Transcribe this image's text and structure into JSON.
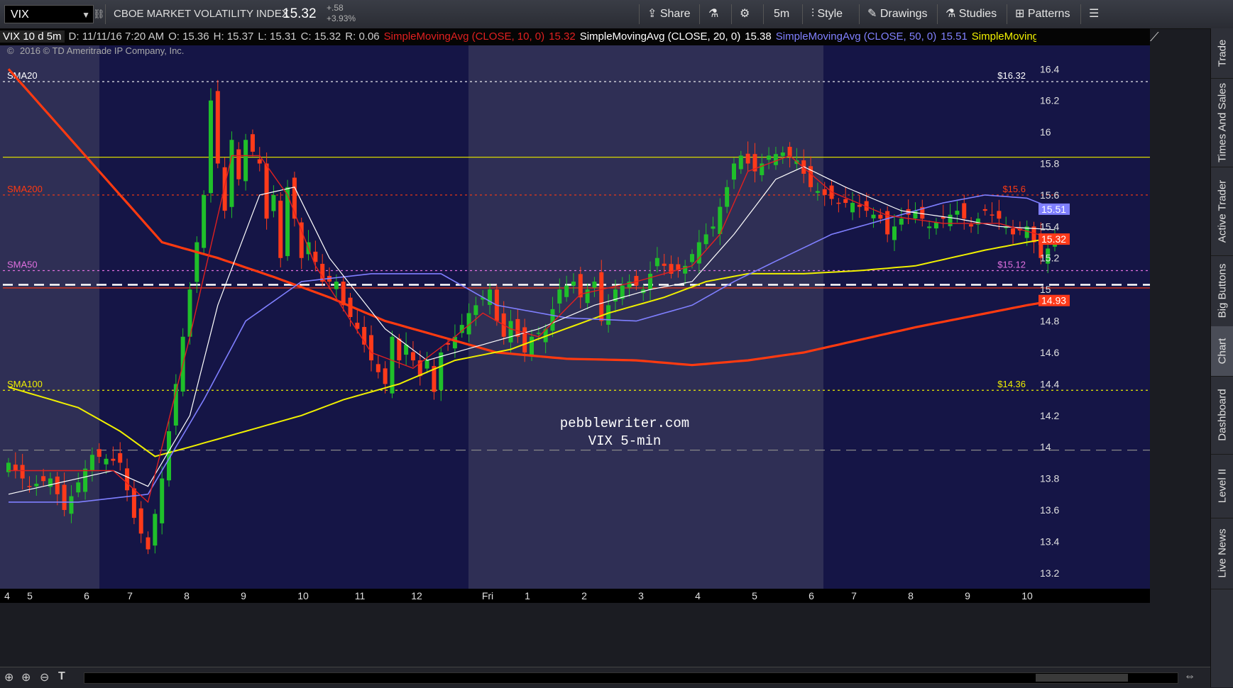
{
  "toolbar": {
    "symbol": "VIX",
    "index_name": "CBOE MARKET VOLATILITY INDEX",
    "last_price": "15.32",
    "change": "+.58",
    "change_pct": "+3.93%",
    "share_label": "Share",
    "timeframe_label": "5m",
    "style_label": "Style",
    "drawings_label": "Drawings",
    "studies_label": "Studies",
    "patterns_label": "Patterns"
  },
  "infobar": {
    "period": "VIX 10 d 5m",
    "date": "D: 11/11/16 7:20 AM",
    "open": "O: 15.36",
    "high": "H: 15.37",
    "low": "L: 15.31",
    "close": "C: 15.32",
    "range": "R: 0.06",
    "sma10_label": "SimpleMovingAvg (CLOSE, 10, 0)",
    "sma10_value": "15.32",
    "sma20_label": "SimpleMovingAvg (CLOSE, 20, 0)",
    "sma20_value": "15.38",
    "sma50_label": "SimpleMovingAvg (CLOSE, 50, 0)",
    "sma50_value": "15.51",
    "sma100_label": "SimpleMoving..."
  },
  "copyright": "2016 © TD Ameritrade IP Company, Inc.",
  "watermark": [
    "pebblewriter.com",
    "VIX 5-min"
  ],
  "colors": {
    "background": "#151546",
    "session_shade": "#2f2f55",
    "candle_up": "#1fbf2a",
    "candle_down": "#ff3a1a",
    "sma10": "#e02020",
    "sma20": "#ffffff",
    "sma50": "#7f7fff",
    "sma100": "#f0f000",
    "sma200": "#ff3a10"
  },
  "side_tabs": [
    "Trade",
    "Times And Sales",
    "Active Trader",
    "Big Buttons",
    "Chart",
    "Dashboard",
    "Level II",
    "Live News"
  ],
  "chart_data": {
    "type": "candlestick",
    "x_tick_labels": [
      "4",
      "5",
      "6",
      "7",
      "8",
      "9",
      "10",
      "11",
      "12",
      "Fri",
      "1",
      "2",
      "3",
      "4",
      "5",
      "6",
      "7",
      "8",
      "9",
      "10"
    ],
    "y_ticks": [
      16.4,
      16.2,
      16,
      15.8,
      15.6,
      15.4,
      15.2,
      15,
      14.8,
      14.6,
      14.4,
      14.2,
      14,
      13.8,
      13.6,
      13.4,
      13.2
    ],
    "ylim": [
      13.1,
      16.55
    ],
    "price_badges": [
      {
        "value": "15.51",
        "color": "#7f7fff"
      },
      {
        "value": "15.32",
        "color": "#ff3a1a"
      },
      {
        "value": "14.93",
        "color": "#ff3a1a"
      }
    ],
    "levels": [
      {
        "label": "SMA20",
        "value": 16.32,
        "value_text": "$16.32",
        "color": "#ffffff",
        "style": "dotted"
      },
      {
        "label": "SMA200",
        "value": 15.6,
        "value_text": "$15.6",
        "color": "#ff3a10",
        "style": "dotted"
      },
      {
        "label": "SMA50",
        "value": 15.12,
        "value_text": "$15.12",
        "color": "#e070e0",
        "style": "dotted"
      },
      {
        "label": "SMA100",
        "value": 14.36,
        "value_text": "$14.36",
        "color": "#f0f000",
        "style": "dotted"
      },
      {
        "label": "",
        "value": 15.84,
        "value_text": "",
        "color": "#d8d800",
        "style": "solid"
      },
      {
        "label": "",
        "value": 15.03,
        "value_text": "",
        "color": "#ffffff",
        "style": "dashed"
      },
      {
        "label": "",
        "value": 15.01,
        "value_text": "",
        "color": "#ff3a10",
        "style": "solid"
      },
      {
        "label": "",
        "value": 13.98,
        "value_text": "",
        "color": "#888888",
        "style": "dashed"
      }
    ],
    "price_anchors": [
      [
        0,
        13.9
      ],
      [
        3,
        13.75
      ],
      [
        6,
        13.8
      ],
      [
        8,
        13.6
      ],
      [
        12,
        13.95
      ],
      [
        16,
        13.9
      ],
      [
        18,
        13.55
      ],
      [
        20,
        13.35
      ],
      [
        22,
        13.8
      ],
      [
        24,
        14.4
      ],
      [
        26,
        15.0
      ],
      [
        28,
        15.6
      ],
      [
        29,
        16.2
      ],
      [
        30,
        15.8
      ],
      [
        31,
        15.5
      ],
      [
        32,
        15.95
      ],
      [
        33,
        15.7
      ],
      [
        34,
        15.95
      ],
      [
        36,
        15.8
      ],
      [
        37,
        15.45
      ],
      [
        38,
        15.6
      ],
      [
        39,
        15.2
      ],
      [
        40,
        15.65
      ],
      [
        41,
        15.45
      ],
      [
        42,
        15.2
      ],
      [
        43,
        15.3
      ],
      [
        45,
        15.05
      ],
      [
        47,
        15.05
      ],
      [
        48,
        14.9
      ],
      [
        50,
        14.75
      ],
      [
        52,
        14.55
      ],
      [
        54,
        14.4
      ],
      [
        55,
        14.7
      ],
      [
        56,
        14.55
      ],
      [
        57,
        14.65
      ],
      [
        59,
        14.45
      ],
      [
        60,
        14.55
      ],
      [
        61,
        14.35
      ],
      [
        62,
        14.6
      ],
      [
        64,
        14.7
      ],
      [
        66,
        14.85
      ],
      [
        68,
        14.95
      ],
      [
        69,
        15.0
      ],
      [
        70,
        14.8
      ],
      [
        71,
        14.7
      ],
      [
        72,
        14.8
      ],
      [
        74,
        14.6
      ],
      [
        75,
        14.7
      ],
      [
        77,
        14.75
      ],
      [
        79,
        15.0
      ],
      [
        81,
        15.05
      ],
      [
        82,
        14.95
      ],
      [
        84,
        15.05
      ],
      [
        85,
        14.8
      ],
      [
        87,
        15.0
      ],
      [
        89,
        15.05
      ],
      [
        91,
        15.0
      ],
      [
        93,
        15.2
      ],
      [
        95,
        15.1
      ],
      [
        97,
        15.15
      ],
      [
        99,
        15.3
      ],
      [
        101,
        15.4
      ],
      [
        103,
        15.65
      ],
      [
        104,
        15.8
      ],
      [
        105,
        15.85
      ],
      [
        107,
        15.75
      ],
      [
        109,
        15.85
      ],
      [
        111,
        15.87
      ],
      [
        113,
        15.82
      ],
      [
        115,
        15.65
      ],
      [
        117,
        15.6
      ],
      [
        119,
        15.55
      ],
      [
        121,
        15.55
      ],
      [
        123,
        15.5
      ],
      [
        125,
        15.45
      ],
      [
        126,
        15.35
      ],
      [
        128,
        15.45
      ],
      [
        130,
        15.5
      ],
      [
        132,
        15.4
      ],
      [
        134,
        15.45
      ],
      [
        136,
        15.5
      ],
      [
        138,
        15.4
      ],
      [
        140,
        15.5
      ],
      [
        142,
        15.45
      ],
      [
        144,
        15.35
      ],
      [
        146,
        15.4
      ],
      [
        148,
        15.2
      ],
      [
        150,
        15.32
      ]
    ],
    "sma10_anchors": [
      [
        0,
        13.85
      ],
      [
        15,
        13.85
      ],
      [
        20,
        13.65
      ],
      [
        26,
        14.7
      ],
      [
        32,
        15.85
      ],
      [
        36,
        15.85
      ],
      [
        40,
        15.6
      ],
      [
        44,
        15.15
      ],
      [
        52,
        14.6
      ],
      [
        58,
        14.5
      ],
      [
        64,
        14.7
      ],
      [
        68,
        14.85
      ],
      [
        72,
        14.75
      ],
      [
        76,
        14.7
      ],
      [
        82,
        14.97
      ],
      [
        90,
        15.05
      ],
      [
        98,
        15.15
      ],
      [
        102,
        15.35
      ],
      [
        106,
        15.75
      ],
      [
        112,
        15.85
      ],
      [
        118,
        15.62
      ],
      [
        126,
        15.47
      ],
      [
        134,
        15.42
      ],
      [
        142,
        15.42
      ],
      [
        150,
        15.32
      ]
    ],
    "sma20_anchors": [
      [
        0,
        13.7
      ],
      [
        15,
        13.85
      ],
      [
        20,
        13.75
      ],
      [
        26,
        14.2
      ],
      [
        30,
        14.9
      ],
      [
        36,
        15.6
      ],
      [
        41,
        15.65
      ],
      [
        46,
        15.2
      ],
      [
        54,
        14.75
      ],
      [
        60,
        14.55
      ],
      [
        68,
        14.65
      ],
      [
        76,
        14.75
      ],
      [
        84,
        14.9
      ],
      [
        92,
        15.0
      ],
      [
        98,
        15.05
      ],
      [
        104,
        15.35
      ],
      [
        110,
        15.7
      ],
      [
        114,
        15.78
      ],
      [
        120,
        15.65
      ],
      [
        128,
        15.5
      ],
      [
        136,
        15.45
      ],
      [
        142,
        15.4
      ],
      [
        150,
        15.38
      ]
    ],
    "sma50_anchors": [
      [
        0,
        13.65
      ],
      [
        10,
        13.65
      ],
      [
        20,
        13.7
      ],
      [
        28,
        14.3
      ],
      [
        34,
        14.8
      ],
      [
        42,
        15.05
      ],
      [
        52,
        15.1
      ],
      [
        62,
        15.1
      ],
      [
        70,
        14.9
      ],
      [
        80,
        14.82
      ],
      [
        90,
        14.8
      ],
      [
        98,
        14.9
      ],
      [
        104,
        15.05
      ],
      [
        110,
        15.18
      ],
      [
        118,
        15.35
      ],
      [
        126,
        15.45
      ],
      [
        134,
        15.55
      ],
      [
        140,
        15.6
      ],
      [
        146,
        15.58
      ],
      [
        150,
        15.51
      ]
    ],
    "sma100_anchors": [
      [
        0,
        14.38
      ],
      [
        10,
        14.25
      ],
      [
        16,
        14.1
      ],
      [
        21,
        13.94
      ],
      [
        26,
        14.0
      ],
      [
        34,
        14.1
      ],
      [
        42,
        14.2
      ],
      [
        48,
        14.3
      ],
      [
        56,
        14.4
      ],
      [
        64,
        14.55
      ],
      [
        72,
        14.62
      ],
      [
        78,
        14.72
      ],
      [
        86,
        14.85
      ],
      [
        94,
        14.95
      ],
      [
        100,
        15.05
      ],
      [
        106,
        15.1
      ],
      [
        114,
        15.1
      ],
      [
        122,
        15.12
      ],
      [
        130,
        15.15
      ],
      [
        140,
        15.25
      ],
      [
        146,
        15.3
      ],
      [
        150,
        15.33
      ]
    ],
    "sma200_anchors": [
      [
        0,
        16.4
      ],
      [
        8,
        16.0
      ],
      [
        16,
        15.6
      ],
      [
        22,
        15.3
      ],
      [
        30,
        15.2
      ],
      [
        38,
        15.08
      ],
      [
        46,
        14.95
      ],
      [
        54,
        14.8
      ],
      [
        62,
        14.7
      ],
      [
        70,
        14.6
      ],
      [
        80,
        14.56
      ],
      [
        90,
        14.55
      ],
      [
        98,
        14.52
      ],
      [
        106,
        14.55
      ],
      [
        114,
        14.6
      ],
      [
        122,
        14.68
      ],
      [
        130,
        14.76
      ],
      [
        138,
        14.83
      ],
      [
        146,
        14.9
      ],
      [
        150,
        14.93
      ]
    ]
  }
}
